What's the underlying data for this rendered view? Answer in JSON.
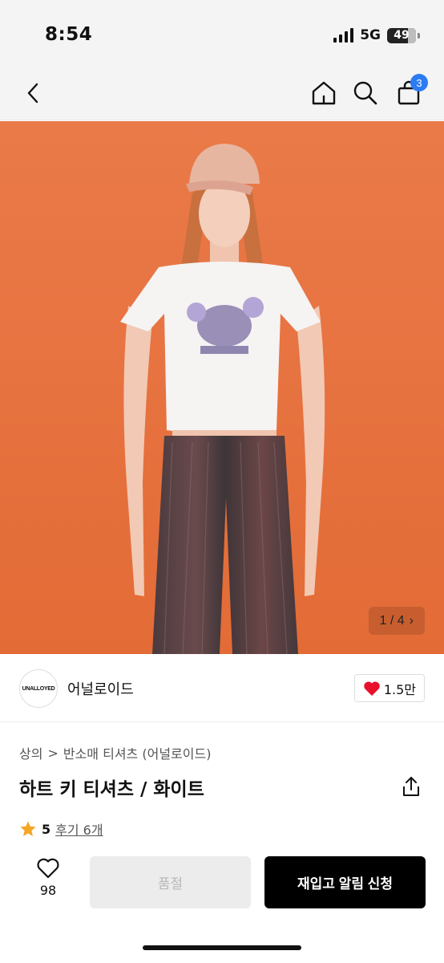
{
  "status_bar": {
    "time": "8:54",
    "network": "5G",
    "battery": "49"
  },
  "nav": {
    "cart_count": "3",
    "icons": [
      "back-icon",
      "home-icon",
      "search-icon",
      "cart-icon"
    ]
  },
  "gallery": {
    "counter": "1 / 4",
    "counter_arrow": "›"
  },
  "brand": {
    "logo_text": "UNALLOYED",
    "name": "어널로이드",
    "likes": "1.5만"
  },
  "breadcrumb": {
    "category": "상의",
    "separator": ">",
    "subcategory": "반소매 티셔츠 (어널로이드)"
  },
  "product": {
    "title": "하트 키 티셔츠 / 화이트"
  },
  "rating": {
    "score": "5",
    "reviews": "후기 6개"
  },
  "actions": {
    "heart_count": "98",
    "soldout_label": "품절",
    "restock_label": "재입고 알림 신청"
  },
  "colors": {
    "accent": "#2b7bf2",
    "heart": "#e8112d",
    "star": "#f5a623",
    "image_bg": "#e8703f"
  }
}
